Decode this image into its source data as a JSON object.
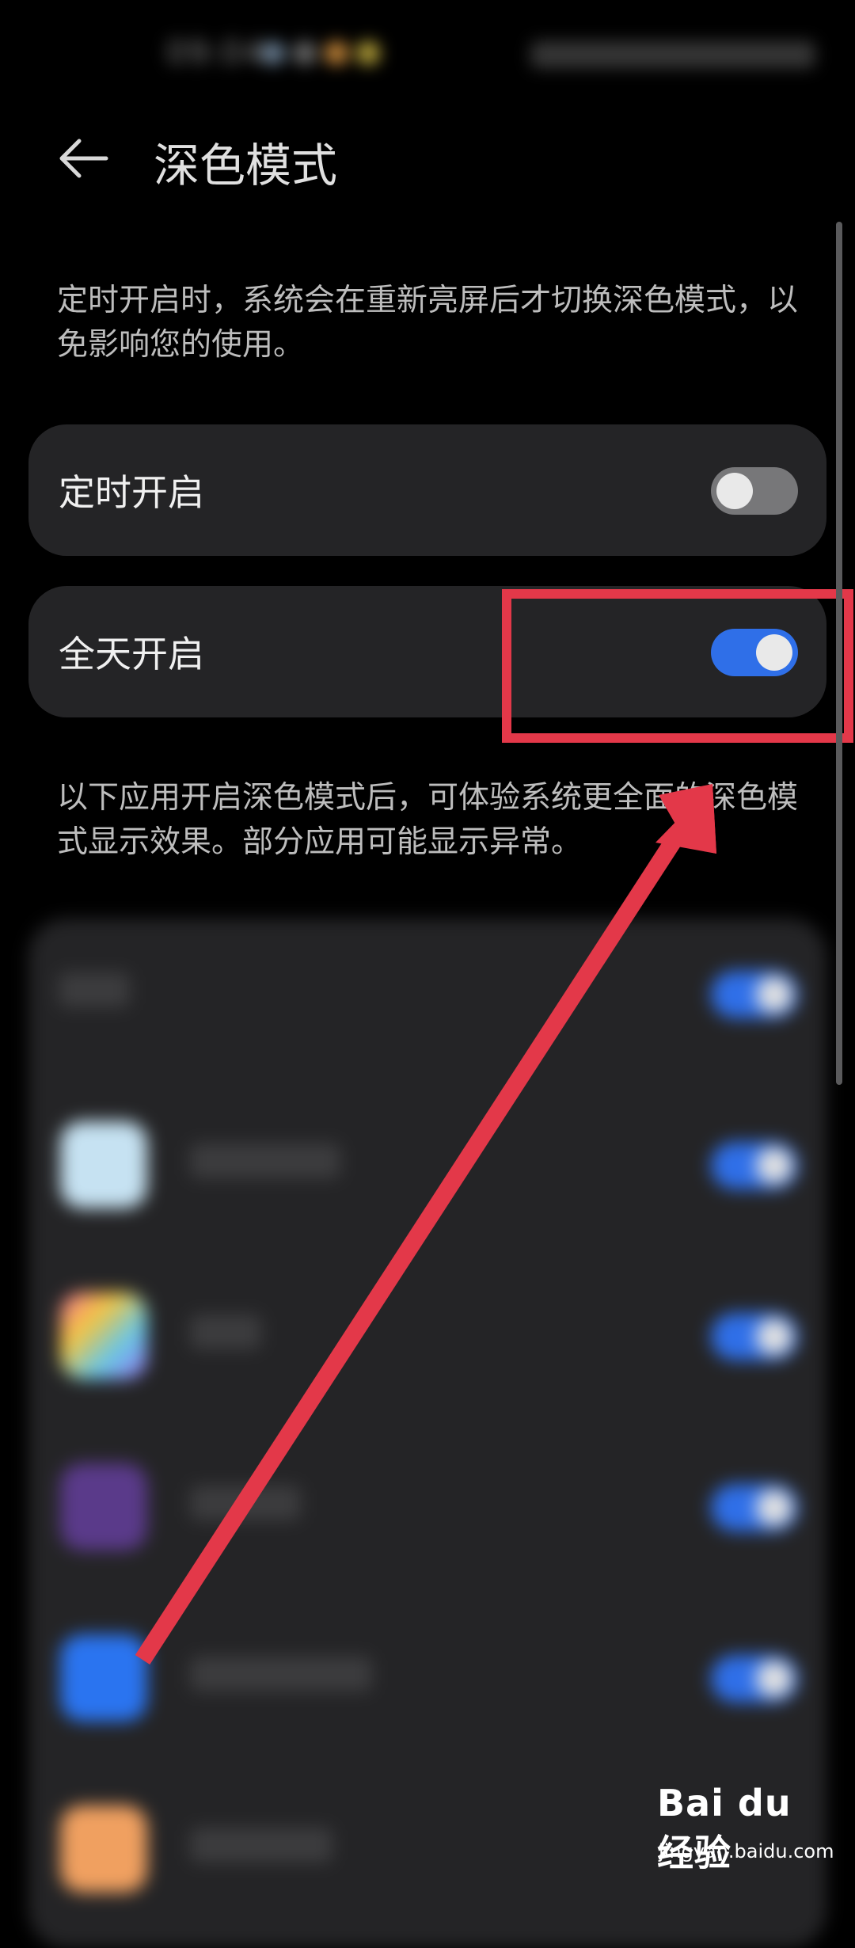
{
  "status_bar": {
    "time": "09:04"
  },
  "header": {
    "title": "深色模式"
  },
  "hint_schedule": "定时开启时，系统会在重新亮屏后才切换深色模式，以免影响您的使用。",
  "settings": [
    {
      "label": "定时开启",
      "state": "off"
    },
    {
      "label": "全天开启",
      "state": "on"
    }
  ],
  "hint_apps": "以下应用开启深色模式后，可体验系统更全面的深色模式显示效果。部分应用可能显示异常。",
  "colors": {
    "background": "#000000",
    "card": "#242426",
    "toggle_on": "#2f6fe8",
    "toggle_off": "#777779",
    "annotation_red": "#e33849"
  },
  "watermark": {
    "logo": "Bai du 经验",
    "url": "jingyan.baidu.com"
  }
}
